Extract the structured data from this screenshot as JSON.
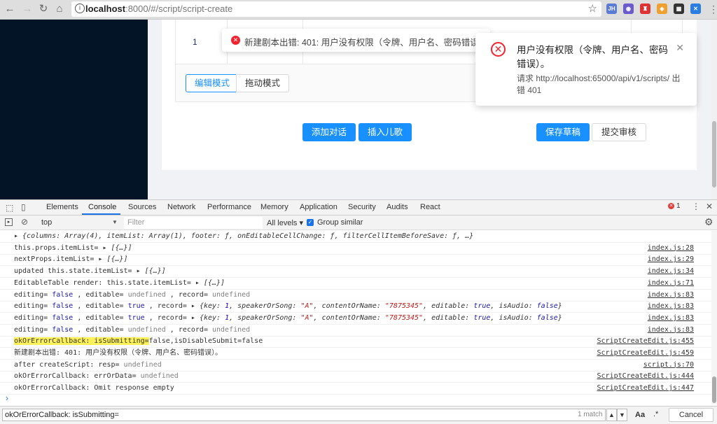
{
  "browser": {
    "url_host": "localhost",
    "url_rest": ":8000/#/script/script-create",
    "extensions": [
      {
        "label": "JH",
        "color": "#5b7bd5"
      },
      {
        "label": "◉",
        "color": "#6a5acd"
      },
      {
        "label": "♜",
        "color": "#d33"
      },
      {
        "label": "◈",
        "color": "#f0a030"
      },
      {
        "label": "▦",
        "color": "#333"
      },
      {
        "label": "✕",
        "color": "#2a7de1"
      }
    ]
  },
  "page": {
    "row_number": "1",
    "mode_edit": "编辑模式",
    "mode_drag": "拖动模式",
    "add_dialog": "添加对话",
    "insert_song": "插入儿歌",
    "save_draft": "保存草稿",
    "submit_review": "提交审核"
  },
  "message": {
    "text": "新建剧本出错: 401: 用户没有权限（令牌、用户名、密码错误）。"
  },
  "notification": {
    "title": "用户没有权限（令牌、用户名、密码错误）。",
    "description": "请求 http://localhost:65000/api/v1/scripts/ 出错 401"
  },
  "devtools": {
    "tabs": [
      "Elements",
      "Console",
      "Sources",
      "Network",
      "Performance",
      "Memory",
      "Application",
      "Security",
      "Audits",
      "React"
    ],
    "error_count": "1",
    "context": "top",
    "filter_placeholder": "Filter",
    "levels": "All levels ▾",
    "group_similar": "Group similar",
    "search_value": "okOrErrorCallback: isSubmitting=",
    "match_count": "1 match",
    "case_label": "Aa",
    "regex_label": ".*",
    "cancel": "Cancel"
  },
  "console_lines": [
    {
      "src": "",
      "parts": [
        {
          "t": "▸ {columns: Array(4), itemList: Array(1), footer: ƒ, onEditableCellChange: ƒ, filterCellItemBeforeSave: ƒ, …}",
          "c": "it"
        }
      ]
    },
    {
      "src": "index.js:28",
      "parts": [
        {
          "t": "this.props.itemList= ",
          "c": ""
        },
        {
          "t": "▸ [{…}]",
          "c": "it"
        }
      ]
    },
    {
      "src": "index.js:29",
      "parts": [
        {
          "t": "nextProps.itemList= ",
          "c": ""
        },
        {
          "t": "▸ [{…}]",
          "c": "it"
        }
      ]
    },
    {
      "src": "index.js:34",
      "parts": [
        {
          "t": "updated this.state.itemList= ",
          "c": ""
        },
        {
          "t": "▸ [{…}]",
          "c": "it"
        }
      ]
    },
    {
      "src": "index.js:71",
      "parts": [
        {
          "t": "EditableTable render: this.state.itemList= ",
          "c": ""
        },
        {
          "t": "▸ [{…}]",
          "c": "it"
        }
      ]
    },
    {
      "src": "index.js:83",
      "parts": [
        {
          "t": "editing= ",
          "c": ""
        },
        {
          "t": "false",
          "c": "kw"
        },
        {
          "t": " , editable= ",
          "c": ""
        },
        {
          "t": "undefined",
          "c": "un"
        },
        {
          "t": " , record= ",
          "c": ""
        },
        {
          "t": "undefined",
          "c": "un"
        }
      ]
    },
    {
      "src": "index.js:83",
      "parts": [
        {
          "t": "editing= ",
          "c": ""
        },
        {
          "t": "false",
          "c": "kw"
        },
        {
          "t": " , editable= ",
          "c": ""
        },
        {
          "t": "true",
          "c": "kw"
        },
        {
          "t": " , record= ▸ ",
          "c": ""
        },
        {
          "t": "{key: ",
          "c": "it"
        },
        {
          "t": "1",
          "c": "num it"
        },
        {
          "t": ", speakerOrSong: ",
          "c": "it"
        },
        {
          "t": "\"A\"",
          "c": "str it"
        },
        {
          "t": ", contentOrName: ",
          "c": "it"
        },
        {
          "t": "\"7875345\"",
          "c": "str it"
        },
        {
          "t": ", editable: ",
          "c": "it"
        },
        {
          "t": "true",
          "c": "kw it"
        },
        {
          "t": ", isAudio: ",
          "c": "it"
        },
        {
          "t": "false",
          "c": "kw it"
        },
        {
          "t": "}",
          "c": "it"
        }
      ]
    },
    {
      "src": "index.js:83",
      "parts": [
        {
          "t": "editing= ",
          "c": ""
        },
        {
          "t": "false",
          "c": "kw"
        },
        {
          "t": " , editable= ",
          "c": ""
        },
        {
          "t": "true",
          "c": "kw"
        },
        {
          "t": " , record= ▸ ",
          "c": ""
        },
        {
          "t": "{key: ",
          "c": "it"
        },
        {
          "t": "1",
          "c": "num it"
        },
        {
          "t": ", speakerOrSong: ",
          "c": "it"
        },
        {
          "t": "\"A\"",
          "c": "str it"
        },
        {
          "t": ", contentOrName: ",
          "c": "it"
        },
        {
          "t": "\"7875345\"",
          "c": "str it"
        },
        {
          "t": ", editable: ",
          "c": "it"
        },
        {
          "t": "true",
          "c": "kw it"
        },
        {
          "t": ", isAudio: ",
          "c": "it"
        },
        {
          "t": "false",
          "c": "kw it"
        },
        {
          "t": "}",
          "c": "it"
        }
      ]
    },
    {
      "src": "index.js:83",
      "parts": [
        {
          "t": "editing= ",
          "c": ""
        },
        {
          "t": "false",
          "c": "kw"
        },
        {
          "t": " , editable= ",
          "c": ""
        },
        {
          "t": "undefined",
          "c": "un"
        },
        {
          "t": " , record= ",
          "c": ""
        },
        {
          "t": "undefined",
          "c": "un"
        }
      ]
    },
    {
      "src": "ScriptCreateEdit.js:455",
      "parts": [
        {
          "t": "okOrErrorCallback: isSubmitting=",
          "c": "hl"
        },
        {
          "t": "false,isDisableSubmit=false",
          "c": ""
        }
      ]
    },
    {
      "src": "ScriptCreateEdit.js:459",
      "parts": [
        {
          "t": "新建剧本出错: 401: 用户没有权限（令牌、用户名、密码错误）。",
          "c": ""
        }
      ]
    },
    {
      "src": "script.js:70",
      "parts": [
        {
          "t": "after createScript: resp= ",
          "c": ""
        },
        {
          "t": "undefined",
          "c": "un"
        }
      ]
    },
    {
      "src": "ScriptCreateEdit.js:444",
      "parts": [
        {
          "t": "okOrErrorCallback: errOrData= ",
          "c": ""
        },
        {
          "t": "undefined",
          "c": "un"
        }
      ]
    },
    {
      "src": "ScriptCreateEdit.js:447",
      "parts": [
        {
          "t": "okOrErrorCallback: Omit response empty",
          "c": ""
        }
      ]
    }
  ]
}
